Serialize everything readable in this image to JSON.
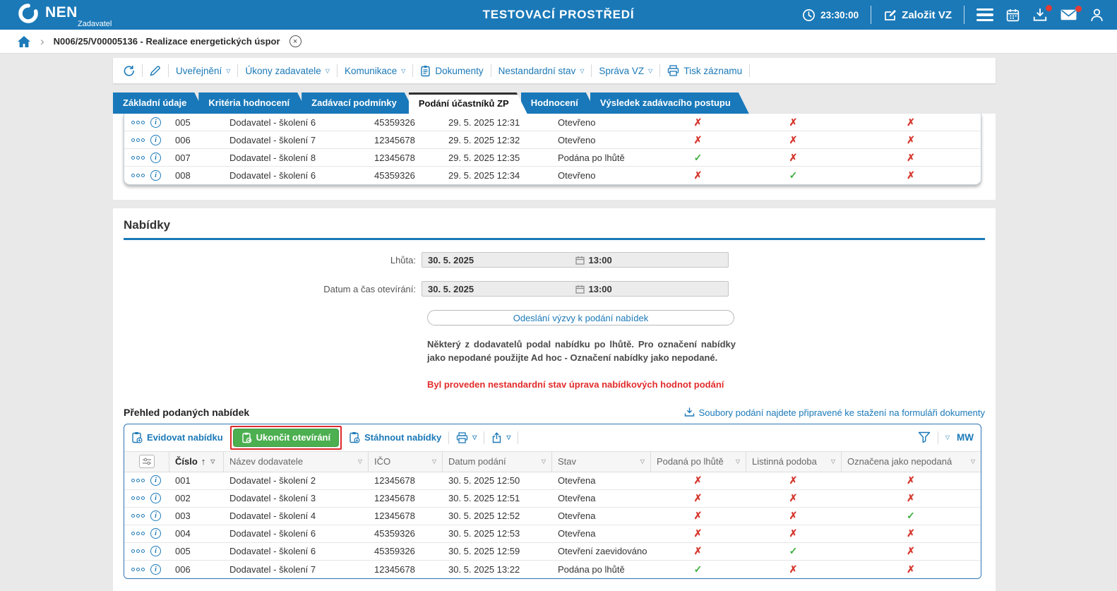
{
  "icons": {
    "chevron_down": "▽",
    "sort_asc": "↑",
    "check_yes": "✓",
    "check_no": "✗",
    "breadcrumb_sep": "›",
    "close": "×",
    "info": "i"
  },
  "topbar": {
    "logo_text": "NEN",
    "logo_subtext": "Zadavatel",
    "environment_title": "TESTOVACÍ PROSTŘEDÍ",
    "clock_time": "23:30:00",
    "create_vz_label": "Založit VZ"
  },
  "breadcrumb": {
    "item_label": "N006/25/V00005136 - Realizace energetických úspor"
  },
  "record_toolbar": {
    "items": [
      {
        "label": "Uveřejnění"
      },
      {
        "label": "Úkony zadavatele"
      },
      {
        "label": "Komunikace"
      },
      {
        "label": "Dokumenty"
      },
      {
        "label": "Nestandardní stav"
      },
      {
        "label": "Správa VZ"
      },
      {
        "label": "Tisk záznamu"
      }
    ]
  },
  "tabs": [
    {
      "label": "Základní údaje",
      "active": false
    },
    {
      "label": "Kritéria hodnocení",
      "active": false
    },
    {
      "label": "Zadávací podmínky",
      "active": false
    },
    {
      "label": "Podání účastníků ZP",
      "active": true
    },
    {
      "label": "Hodnocení",
      "active": false
    },
    {
      "label": "Výsledek zadávacího postupu",
      "active": false
    }
  ],
  "participants_table": {
    "rows": [
      {
        "cislo": "005",
        "dodavatel": "Dodavatel - školení 6",
        "ico": "45359326",
        "datum": "29. 5. 2025 12:31",
        "stav": "Otevřeno",
        "po_lhute": false,
        "listinna": false,
        "nepodana": false
      },
      {
        "cislo": "006",
        "dodavatel": "Dodavatel - školení 7",
        "ico": "12345678",
        "datum": "29. 5. 2025 12:32",
        "stav": "Otevřeno",
        "po_lhute": false,
        "listinna": false,
        "nepodana": false
      },
      {
        "cislo": "007",
        "dodavatel": "Dodavatel - školení 8",
        "ico": "12345678",
        "datum": "29. 5. 2025 12:35",
        "stav": "Podána po lhůtě",
        "po_lhute": true,
        "listinna": false,
        "nepodana": false
      },
      {
        "cislo": "008",
        "dodavatel": "Dodavatel - školení 6",
        "ico": "45359326",
        "datum": "29. 5. 2025 12:34",
        "stav": "Otevřeno",
        "po_lhute": false,
        "listinna": true,
        "nepodana": false
      }
    ]
  },
  "offers_section": {
    "title": "Nabídky",
    "lhuta_label": "Lhůta:",
    "lhuta_date": "30. 5. 2025",
    "lhuta_time": "13:00",
    "otevirani_label": "Datum a čas otevírání:",
    "otevirani_date": "30. 5. 2025",
    "otevirani_time": "13:00",
    "send_button_label": "Odeslání výzvy k podání nabídek",
    "late_notice": "Některý z dodavatelů podal nabídku po lhůtě. Pro označení nabídky jako nepodané použijte Ad hoc - Označení nabídky jako nepodané.",
    "nonstandard_alert": "Byl proveden nestandardní stav úprava nabídkových hodnot podání",
    "overview_title": "Přehled podaných nabídek",
    "download_link_label": "Soubory podání najdete připravené ke stažení na formuláři dokumenty",
    "toolbar": {
      "evidovat_label": "Evidovat nabídku",
      "ukoncit_label": "Ukončit otevírání",
      "stahnout_label": "Stáhnout nabídky",
      "user_code": "MW"
    },
    "table": {
      "headers": [
        "Číslo",
        "Název dodavatele",
        "IČO",
        "Datum podání",
        "Stav",
        "Podaná po lhůtě",
        "Listinná podoba",
        "Označena jako nepodaná"
      ],
      "rows": [
        {
          "cislo": "001",
          "dodavatel": "Dodavatel - školení 2",
          "ico": "12345678",
          "datum": "30. 5. 2025 12:50",
          "stav": "Otevřena",
          "po_lhute": false,
          "listinna": false,
          "nepodana": false
        },
        {
          "cislo": "002",
          "dodavatel": "Dodavatel - školení 3",
          "ico": "12345678",
          "datum": "30. 5. 2025 12:51",
          "stav": "Otevřena",
          "po_lhute": false,
          "listinna": false,
          "nepodana": false
        },
        {
          "cislo": "003",
          "dodavatel": "Dodavatel - školení 4",
          "ico": "12345678",
          "datum": "30. 5. 2025 12:52",
          "stav": "Otevřena",
          "po_lhute": false,
          "listinna": false,
          "nepodana": true
        },
        {
          "cislo": "004",
          "dodavatel": "Dodavatel - školení 6",
          "ico": "45359326",
          "datum": "30. 5. 2025 12:53",
          "stav": "Otevřena",
          "po_lhute": false,
          "listinna": false,
          "nepodana": false
        },
        {
          "cislo": "005",
          "dodavatel": "Dodavatel - školení 6",
          "ico": "45359326",
          "datum": "30. 5. 2025 12:59",
          "stav": "Otevření zaevidováno",
          "po_lhute": false,
          "listinna": true,
          "nepodana": false
        },
        {
          "cislo": "006",
          "dodavatel": "Dodavatel - školení 7",
          "ico": "12345678",
          "datum": "30. 5. 2025 13:22",
          "stav": "Podána po lhůtě",
          "po_lhute": true,
          "listinna": false,
          "nepodana": false
        }
      ]
    }
  },
  "colors": {
    "accent_blue": "#1b79b8",
    "tab_blue": "#1878ba",
    "success_green": "#3faf41",
    "danger_red": "#d63a30",
    "button_green": "#4caf50",
    "alert_red": "#e22b2b"
  }
}
